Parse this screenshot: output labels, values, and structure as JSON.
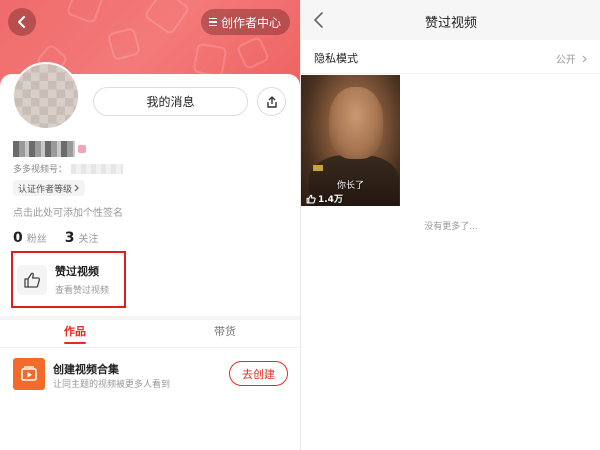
{
  "left": {
    "header": {
      "creator_center": "创作者中心"
    },
    "profile": {
      "message_button": "我的消息",
      "id_label": "多多视频号：",
      "cert_tag": "认证作者等级",
      "signature_placeholder": "点击此处可添加个性签名",
      "followers_count": "0",
      "followers_label": "粉丝",
      "following_count": "3",
      "following_label": "关注"
    },
    "liked_videos": {
      "title": "赞过视频",
      "subtitle": "查看赞过视频"
    },
    "tabs": [
      {
        "label": "作品",
        "active": true
      },
      {
        "label": "带货",
        "active": false
      }
    ],
    "collection": {
      "title": "创建视频合集",
      "subtitle": "让同主题的视频被更多人看到",
      "button": "去创建"
    },
    "colors": {
      "accent": "#e02e24",
      "banner": "#f47a7a",
      "highlight_border": "#e21c1c",
      "collection_icon": "#f26b2b"
    }
  },
  "right": {
    "title": "赞过视频",
    "privacy": {
      "label": "隐私模式",
      "value": "公开"
    },
    "videos": [
      {
        "caption": "你长了",
        "likes": "1.4万"
      }
    ],
    "no_more": "没有更多了..."
  },
  "icons": [
    "back-icon",
    "menu-icon",
    "share-icon",
    "thumbs-up-icon",
    "chevron-right-icon",
    "play-icon"
  ]
}
